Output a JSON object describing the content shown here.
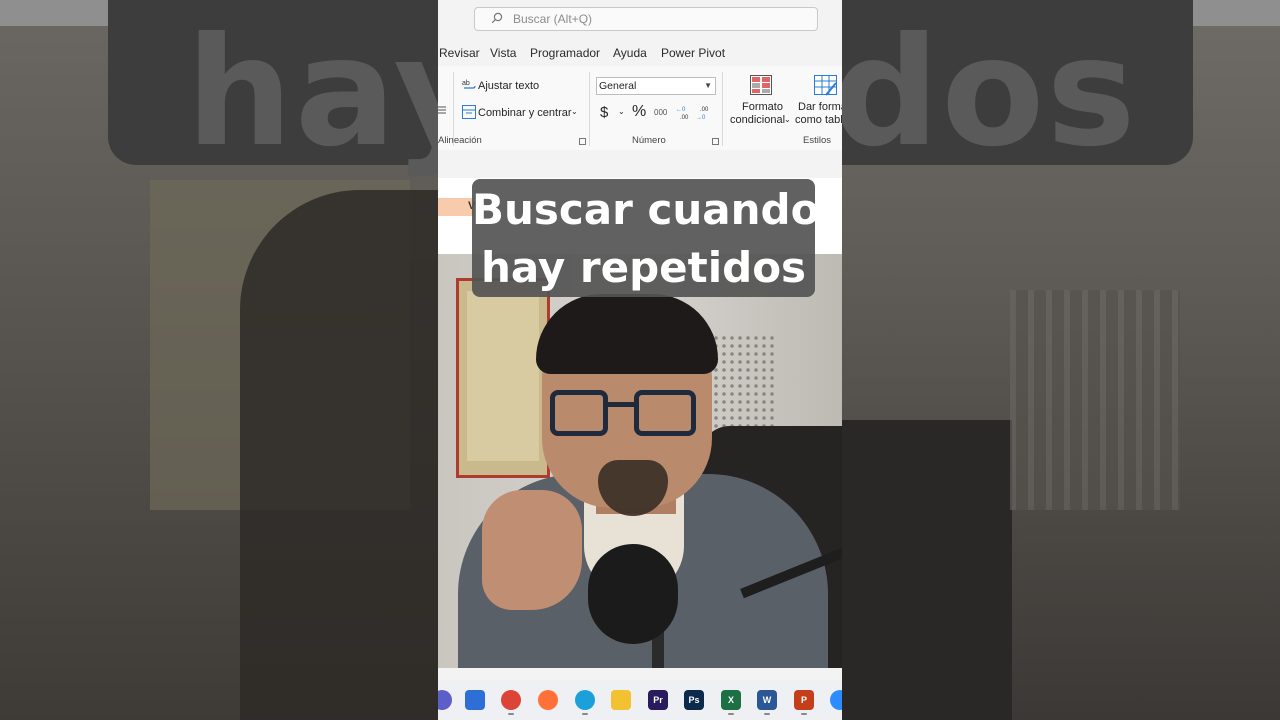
{
  "background_caption": "hay ... idos",
  "caption": {
    "line1": "Buscar cuando",
    "line2": "hay repetidos"
  },
  "titlebar": {
    "search_placeholder": "Buscar (Alt+Q)"
  },
  "menu": [
    "Revisar",
    "Vista",
    "Programador",
    "Ayuda",
    "Power Pivot"
  ],
  "ribbon": {
    "wrap_text": "Ajustar texto",
    "merge_center": "Combinar y centrar",
    "alignment_label": "Alineación",
    "number_format_value": "General",
    "currency_symbol": "$",
    "percent_symbol": "%",
    "thousands_symbol": "000",
    "number_label": "Número",
    "conditional_format_line1": "Formato",
    "conditional_format_line2": "condicional",
    "format_table_line1": "Dar forma",
    "format_table_line2": "como tabl",
    "styles_label": "Estilos"
  },
  "sheet": {
    "visible_cell_text": "V"
  },
  "taskbar_icons": [
    {
      "name": "teams-icon",
      "color": "#5b5fc7",
      "label": ""
    },
    {
      "name": "store-icon",
      "color": "#2d6fd6",
      "label": ""
    },
    {
      "name": "chrome-icon",
      "color": "#db4437",
      "label": ""
    },
    {
      "name": "firefox-icon",
      "color": "#ff7139",
      "label": ""
    },
    {
      "name": "edge-icon",
      "color": "#1ca0d9",
      "label": ""
    },
    {
      "name": "file-explorer-icon",
      "color": "#f2c230",
      "label": ""
    },
    {
      "name": "premiere-icon",
      "color": "#2a1a5e",
      "label": "Pr"
    },
    {
      "name": "photoshop-icon",
      "color": "#0c2a4c",
      "label": "Ps"
    },
    {
      "name": "excel-icon",
      "color": "#1d7044",
      "label": "X"
    },
    {
      "name": "word-icon",
      "color": "#2b5797",
      "label": "W"
    },
    {
      "name": "powerpoint-icon",
      "color": "#c43e1c",
      "label": "P"
    },
    {
      "name": "zoom-icon",
      "color": "#2d8cff",
      "label": ""
    }
  ]
}
